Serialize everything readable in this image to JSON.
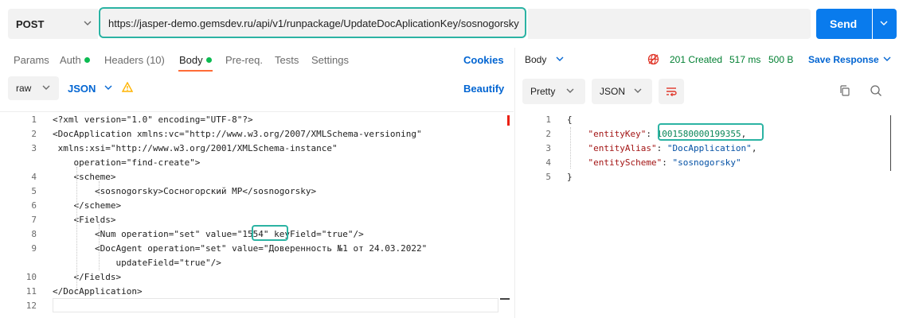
{
  "request": {
    "method": "POST",
    "url": "https://jasper-demo.gemsdev.ru/api/v1/runpackage/UpdateDocAplicationKey/sosnogorsky",
    "send_label": "Send"
  },
  "request_tabs": [
    {
      "label": "Params"
    },
    {
      "label": "Auth"
    },
    {
      "label": "Headers (10)"
    },
    {
      "label": "Body"
    },
    {
      "label": "Pre-req."
    },
    {
      "label": "Tests"
    },
    {
      "label": "Settings"
    }
  ],
  "cookies_label": "Cookies",
  "body_toolbar": {
    "mode": "raw",
    "format": "JSON",
    "beautify_label": "Beautify"
  },
  "request_lines": [
    {
      "num": "1",
      "text": "<?xml version=\"1.0\" encoding=\"UTF-8\"?>"
    },
    {
      "num": "2",
      "text": "<DocApplication xmlns:vc=\"http://www.w3.org/2007/XMLSchema-versioning\""
    },
    {
      "num": "3",
      "text": " xmlns:xsi=\"http://www.w3.org/2001/XMLSchema-instance\""
    },
    {
      "num": "",
      "text": "    operation=\"find-create\">"
    },
    {
      "num": "4",
      "text": "    <scheme>"
    },
    {
      "num": "5",
      "text": "        <sosnogorsky>Сосногорский МР</sosnogorsky>"
    },
    {
      "num": "6",
      "text": "    </scheme>"
    },
    {
      "num": "7",
      "text": "    <Fields>"
    },
    {
      "num": "8",
      "text": "        <Num operation=\"set\" value=\"1554\" keyField=\"true\"/>"
    },
    {
      "num": "9",
      "text": "        <DocAgent operation=\"set\" value=\"Доверенность №1 от 24.03.2022\""
    },
    {
      "num": "",
      "text": "            updateField=\"true\"/>"
    },
    {
      "num": "10",
      "text": "    </Fields>"
    },
    {
      "num": "11",
      "text": "</DocApplication>"
    },
    {
      "num": "12",
      "text": ""
    }
  ],
  "response": {
    "view_label": "Body",
    "status": "201 Created",
    "time": "517 ms",
    "size": "500 B",
    "save_label": "Save Response",
    "pretty_label": "Pretty",
    "format_label": "JSON"
  },
  "response_lines": [
    {
      "num": "1",
      "text": "{"
    },
    {
      "num": "2",
      "key": "\"entityKey\"",
      "sep": ": ",
      "value": "1001580000199355",
      "tail": ","
    },
    {
      "num": "3",
      "key": "\"entityAlias\"",
      "sep": ": ",
      "value": "\"DocApplication\"",
      "tail": ","
    },
    {
      "num": "4",
      "key": "\"entityScheme\"",
      "sep": ": ",
      "value": "\"sosnogorsky\"",
      "tail": ""
    },
    {
      "num": "5",
      "text": "}"
    }
  ],
  "colors": {
    "accent_send": "#097bed",
    "highlight_teal": "#2bb3a3",
    "status_green": "#007f31",
    "tab_active_underline": "#ff6c37",
    "link_blue": "#0265d2"
  }
}
